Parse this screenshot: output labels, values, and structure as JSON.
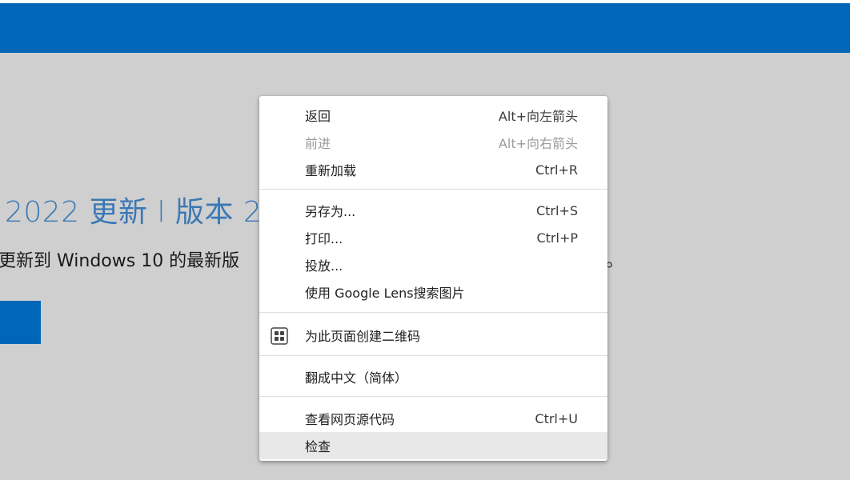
{
  "page": {
    "heading": "2022 更新 l 版本 2",
    "description": "更新到 Windows 10 的最新版",
    "trailing_text": "。"
  },
  "context_menu": {
    "items": [
      {
        "label": "返回",
        "shortcut": "Alt+向左箭头",
        "enabled": true
      },
      {
        "label": "前进",
        "shortcut": "Alt+向右箭头",
        "enabled": false
      },
      {
        "label": "重新加载",
        "shortcut": "Ctrl+R",
        "enabled": true
      },
      {
        "label": "另存为...",
        "shortcut": "Ctrl+S",
        "enabled": true
      },
      {
        "label": "打印...",
        "shortcut": "Ctrl+P",
        "enabled": true
      },
      {
        "label": "投放...",
        "shortcut": "",
        "enabled": true
      },
      {
        "label": "使用 Google Lens搜索图片",
        "shortcut": "",
        "enabled": true
      },
      {
        "label": "为此页面创建二维码",
        "shortcut": "",
        "enabled": true,
        "icon": "qr-code-icon"
      },
      {
        "label": "翻成中文（简体）",
        "shortcut": "",
        "enabled": true
      },
      {
        "label": "查看网页源代码",
        "shortcut": "Ctrl+U",
        "enabled": true
      },
      {
        "label": "检查",
        "shortcut": "",
        "enabled": true,
        "highlighted": true
      }
    ]
  },
  "colors": {
    "banner": "#0067b8",
    "page_background": "#cfcfcf",
    "menu_hover": "#e8e8e8",
    "disabled_text": "#9a9a9a"
  }
}
